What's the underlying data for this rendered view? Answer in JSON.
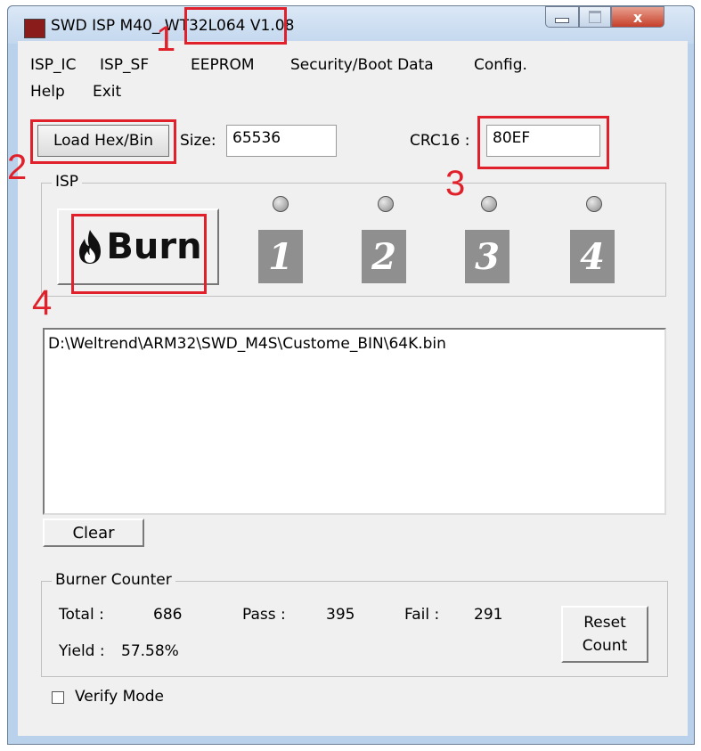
{
  "window": {
    "title": "SWD ISP M40_ WT32L064 V1.08",
    "close_glyph": "x"
  },
  "menu": {
    "items": [
      "ISP_IC",
      "ISP_SF",
      "EEPROM",
      "Security/Boot Data",
      "Config.",
      "Help",
      "Exit"
    ]
  },
  "file": {
    "load_button": "Load Hex/Bin",
    "size_label": "Size:",
    "size_value": "65536",
    "crc_label": "CRC16 :",
    "crc_value": "80EF"
  },
  "isp": {
    "group_title": "ISP",
    "burn_label": "Burn",
    "stations": [
      "1",
      "2",
      "3",
      "4"
    ]
  },
  "log": {
    "lines": [
      "D:\\Weltrend\\ARM32\\SWD_M4S\\Custome_BIN\\64K.bin"
    ],
    "clear_button": "Clear"
  },
  "counter": {
    "group_title": "Burner Counter",
    "total_label": "Total :",
    "total_value": "686",
    "pass_label": "Pass :",
    "pass_value": "395",
    "fail_label": "Fail :",
    "fail_value": "291",
    "yield_label": "Yield :",
    "yield_value": "57.58%",
    "reset_line1": "Reset",
    "reset_line2": "Count"
  },
  "options": {
    "verify_mode_label": "Verify Mode",
    "verify_mode_checked": false
  },
  "annotations": {
    "markers": [
      "1",
      "2",
      "3",
      "4"
    ],
    "color": "#e0202a"
  },
  "icons": {
    "flame": "flame-icon",
    "app": "app-icon"
  }
}
